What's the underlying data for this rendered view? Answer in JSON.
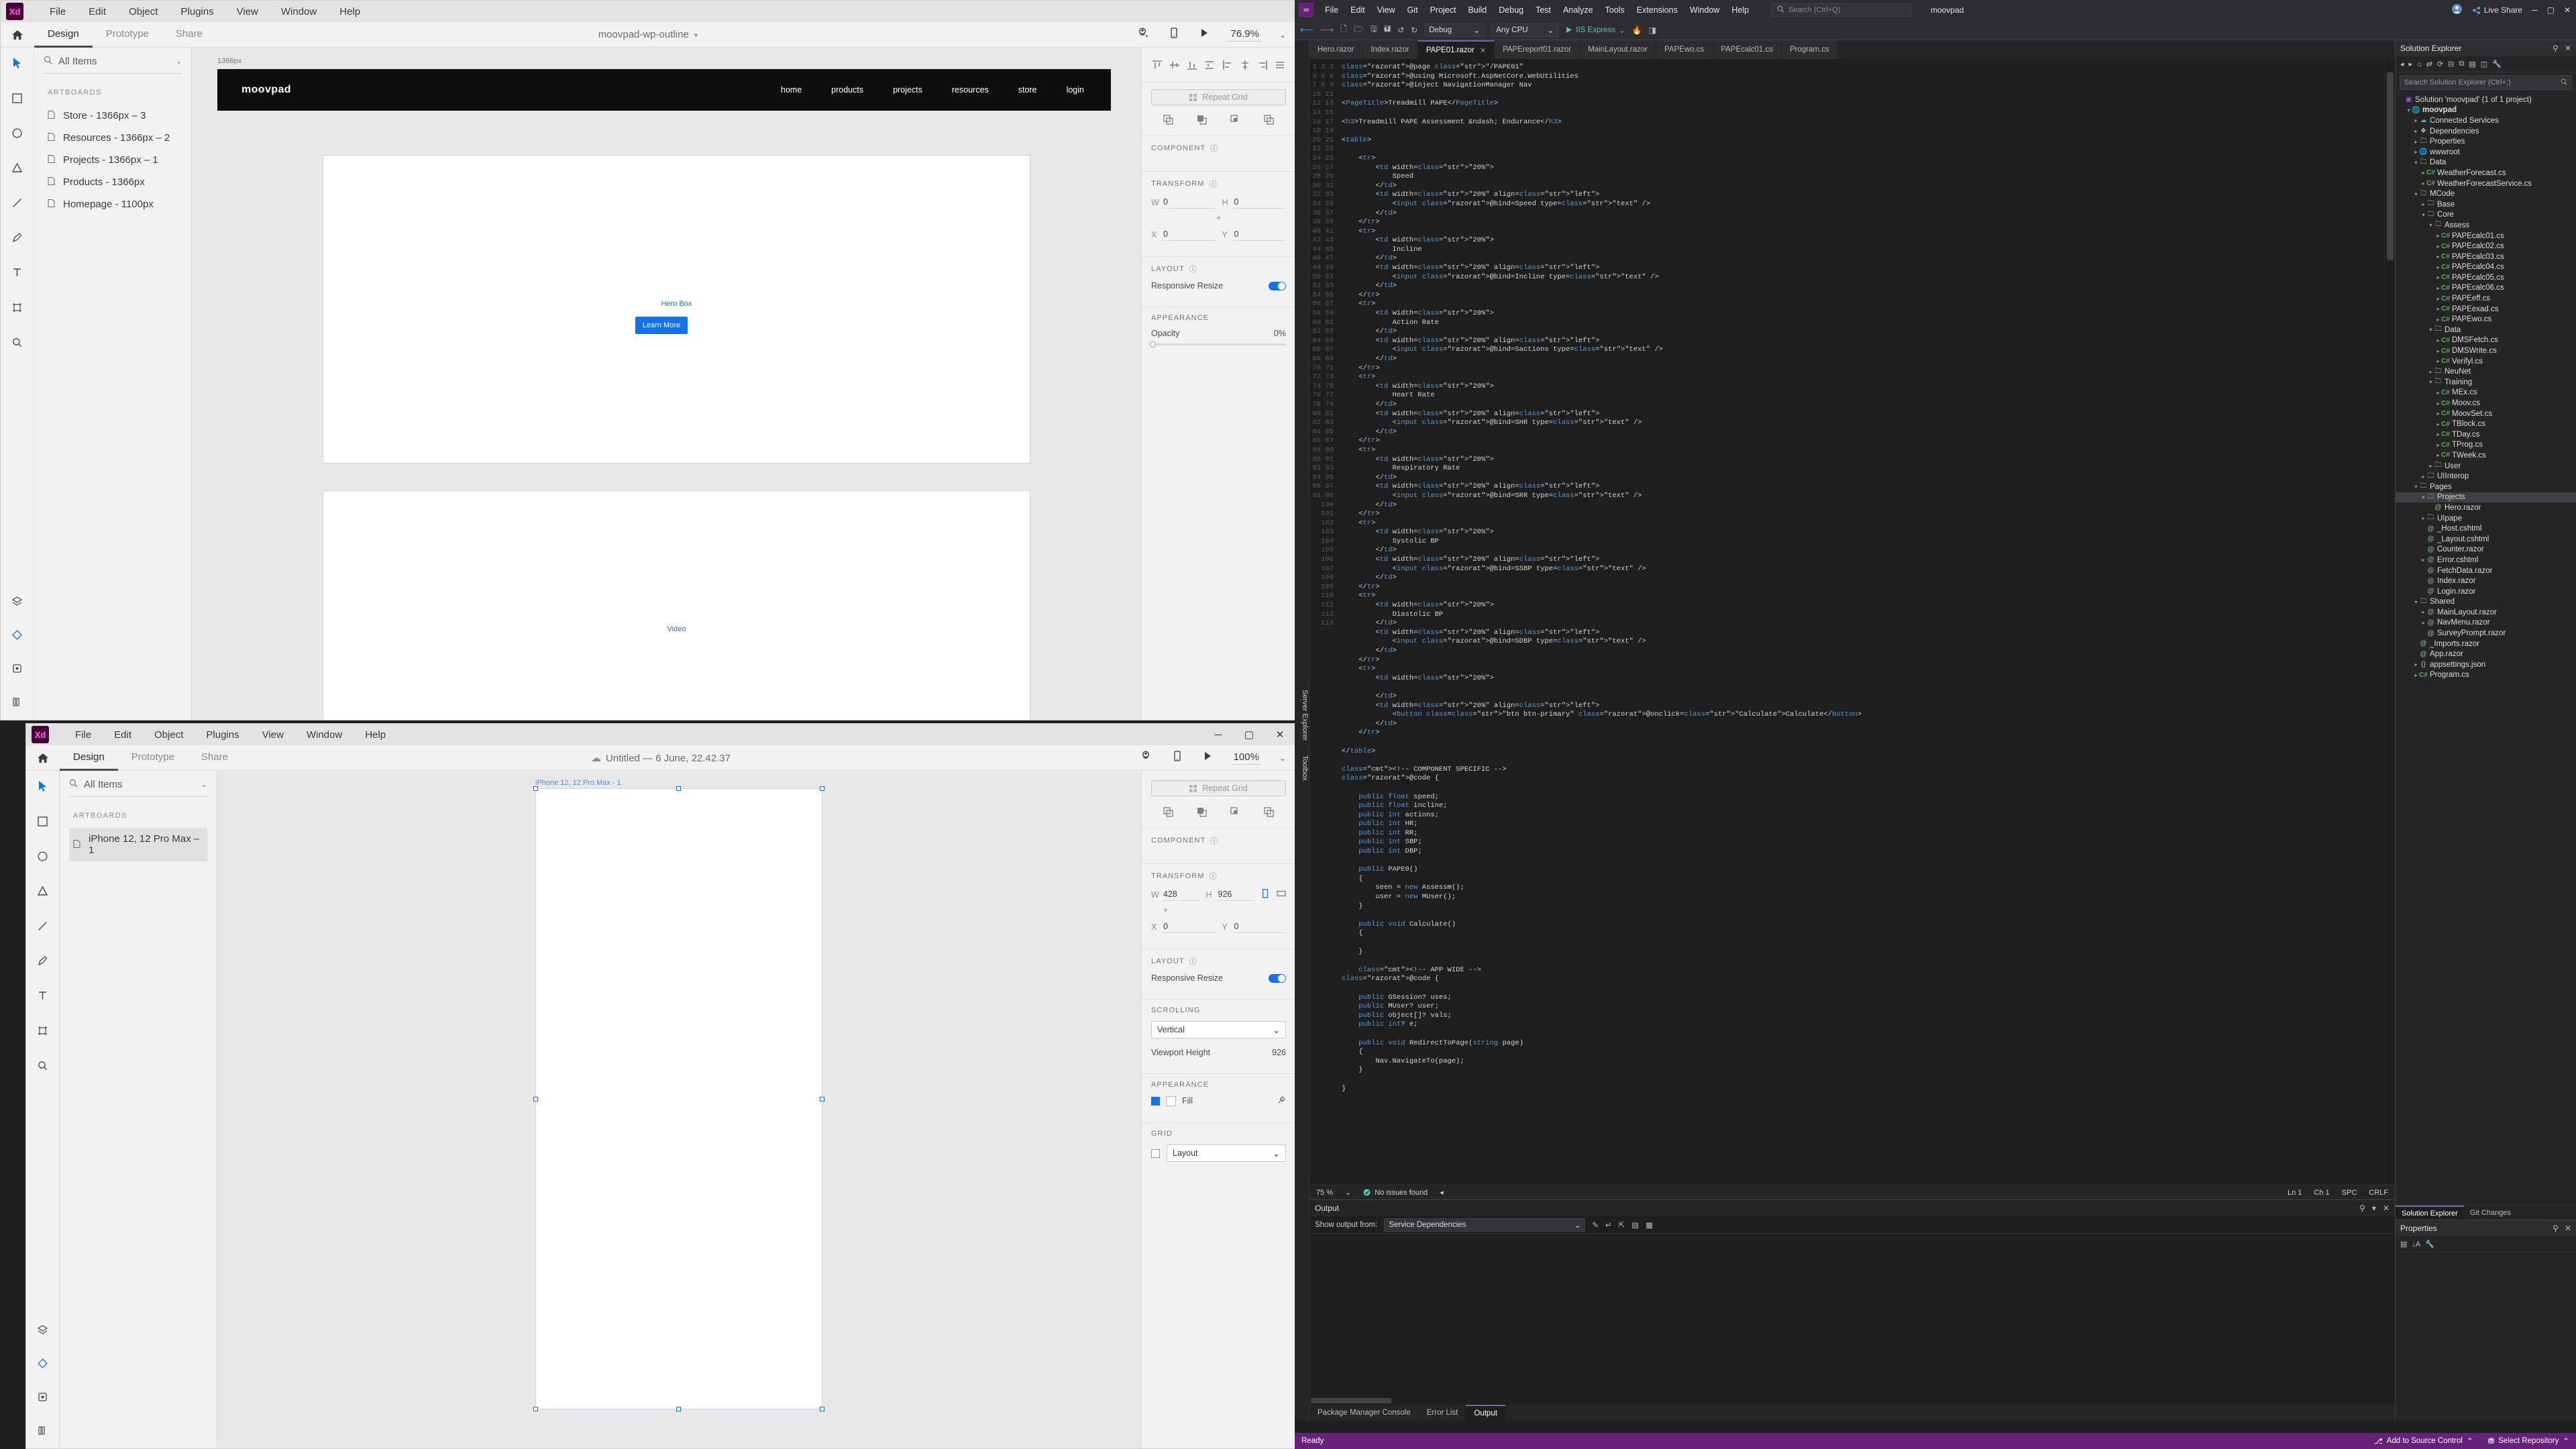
{
  "xd_top": {
    "menu": [
      "File",
      "Edit",
      "Object",
      "Plugins",
      "View",
      "Window",
      "Help"
    ],
    "logo": "Xd",
    "tabs": [
      {
        "label": "Design",
        "active": true
      },
      {
        "label": "Prototype",
        "active": false
      },
      {
        "label": "Share",
        "active": false
      }
    ],
    "document_title": "moovpad-wp-outline",
    "zoom": "76.9%",
    "search_placeholder": "All Items",
    "section_artboards": "ARTBOARDS",
    "artboards": [
      "Store - 1366px – 3",
      "Resources - 1366px – 2",
      "Projects - 1366px – 1",
      "Products - 1366px",
      "Homepage - 1100px"
    ],
    "canvas": {
      "artboard_label": "1366px",
      "nav_brand": "moovpad",
      "nav_links": [
        "home",
        "products",
        "projects",
        "resources",
        "store",
        "login"
      ],
      "hero_caption": "Hero Box",
      "hero_button": "Learn More",
      "video_caption": "Video"
    },
    "right": {
      "repeat_grid": "Repeat Grid",
      "component": "COMPONENT",
      "transform": "TRANSFORM",
      "w_label": "W",
      "w_value": "0",
      "h_label": "H",
      "h_value": "0",
      "x_label": "X",
      "x_value": "0",
      "y_label": "Y",
      "y_value": "0",
      "layout": "LAYOUT",
      "responsive_resize": "Responsive Resize",
      "appearance": "APPEARANCE",
      "opacity_label": "Opacity",
      "opacity_value": "0%"
    }
  },
  "xd_bottom": {
    "menu": [
      "File",
      "Edit",
      "Object",
      "Plugins",
      "View",
      "Window",
      "Help"
    ],
    "logo": "Xd",
    "tabs": [
      {
        "label": "Design",
        "active": true
      },
      {
        "label": "Prototype",
        "active": false
      },
      {
        "label": "Share",
        "active": false
      }
    ],
    "document_title": "Untitled — 6 June, 22.42.37",
    "zoom": "100%",
    "search_placeholder": "All Items",
    "section_artboards": "ARTBOARDS",
    "artboards": [
      "iPhone 12, 12 Pro Max – 1"
    ],
    "canvas": {
      "artboard_label": "iPhone 12, 12 Pro Max - 1"
    },
    "right": {
      "repeat_grid": "Repeat Grid",
      "component": "COMPONENT",
      "transform": "TRANSFORM",
      "w_label": "W",
      "w_value": "428",
      "h_label": "H",
      "h_value": "926",
      "x_label": "X",
      "x_value": "0",
      "y_label": "Y",
      "y_value": "0",
      "layout": "LAYOUT",
      "responsive_resize": "Responsive Resize",
      "scrolling": "SCROLLING",
      "scrolling_value": "Vertical",
      "viewport_height_label": "Viewport Height",
      "viewport_height_value": "926",
      "appearance": "APPEARANCE",
      "fill_label": "Fill",
      "grid": "GRID",
      "grid_value": "Layout"
    }
  },
  "vs": {
    "menu": [
      "File",
      "Edit",
      "View",
      "Git",
      "Project",
      "Build",
      "Debug",
      "Test",
      "Analyze",
      "Tools",
      "Extensions",
      "Window",
      "Help"
    ],
    "search_placeholder": "Search (Ctrl+Q)",
    "title": "moovpad",
    "live_share": "Live Share",
    "toolbar": {
      "config": "Debug",
      "platform": "Any CPU",
      "run_target": "IIS Express",
      "nav_back": "◄",
      "nav_fwd": "►"
    },
    "tabs": [
      {
        "label": "Hero.razor",
        "active": false
      },
      {
        "label": "Index.razor",
        "active": false
      },
      {
        "label": "PAPE01.razor",
        "active": true
      },
      {
        "label": "PAPEreport01.razor",
        "active": false
      },
      {
        "label": "MainLayout.razor",
        "active": false
      },
      {
        "label": "PAPEwo.cs",
        "active": false
      },
      {
        "label": "PAPEcalc01.cs",
        "active": false
      },
      {
        "label": "Program.cs",
        "active": false
      }
    ],
    "server_rail": "Server Explorer",
    "toolbox_rail": "Toolbox",
    "editor_status": {
      "zoom": "75 %",
      "issues": "No issues found",
      "ln": "Ln 1",
      "col": "Ch 1",
      "spc": "SPC",
      "eol": "CRLF"
    },
    "output": {
      "title": "Output",
      "show_output_from_label": "Show output from:",
      "show_output_from_value": "Service Dependencies",
      "tabs": [
        {
          "label": "Package Manager Console",
          "active": false
        },
        {
          "label": "Error List",
          "active": false
        },
        {
          "label": "Output",
          "active": true
        }
      ]
    },
    "solution_explorer": {
      "title": "Solution Explorer",
      "search_placeholder": "Search Solution Explorer (Ctrl+;)",
      "tabs": [
        {
          "label": "Solution Explorer",
          "active": true
        },
        {
          "label": "Git Changes",
          "active": false
        }
      ],
      "tree": [
        {
          "depth": 0,
          "arrow": "",
          "icon": "sln",
          "label": "Solution 'moovpad' (1 of 1 project)",
          "bold": false
        },
        {
          "depth": 1,
          "arrow": "▾",
          "icon": "web",
          "label": "moovpad",
          "bold": true
        },
        {
          "depth": 2,
          "arrow": "▸",
          "icon": "svc",
          "label": "Connected Services",
          "bold": false
        },
        {
          "depth": 2,
          "arrow": "▸",
          "icon": "dep",
          "label": "Dependencies",
          "bold": false
        },
        {
          "depth": 2,
          "arrow": "▸",
          "icon": "prop",
          "label": "Properties",
          "bold": false
        },
        {
          "depth": 2,
          "arrow": "▸",
          "icon": "web",
          "label": "wwwroot",
          "bold": false
        },
        {
          "depth": 2,
          "arrow": "▾",
          "icon": "folder",
          "label": "Data",
          "bold": false
        },
        {
          "depth": 3,
          "arrow": "▸",
          "icon": "cs",
          "label": "WeatherForecast.cs",
          "bold": false
        },
        {
          "depth": 3,
          "arrow": "▸",
          "icon": "cs",
          "label": "WeatherForecastService.cs",
          "bold": false
        },
        {
          "depth": 2,
          "arrow": "▾",
          "icon": "folder",
          "label": "MCode",
          "bold": false
        },
        {
          "depth": 3,
          "arrow": "▸",
          "icon": "folder",
          "label": "Base",
          "bold": false
        },
        {
          "depth": 3,
          "arrow": "▾",
          "icon": "folder",
          "label": "Core",
          "bold": false
        },
        {
          "depth": 4,
          "arrow": "▾",
          "icon": "folder",
          "label": "Assess",
          "bold": false
        },
        {
          "depth": 5,
          "arrow": "▸",
          "icon": "cs",
          "label": "PAPEcalc01.cs",
          "bold": false
        },
        {
          "depth": 5,
          "arrow": "▸",
          "icon": "cs",
          "label": "PAPEcalc02.cs",
          "bold": false
        },
        {
          "depth": 5,
          "arrow": "▸",
          "icon": "cs",
          "label": "PAPEcalc03.cs",
          "bold": false
        },
        {
          "depth": 5,
          "arrow": "▸",
          "icon": "cs",
          "label": "PAPEcalc04.cs",
          "bold": false
        },
        {
          "depth": 5,
          "arrow": "▸",
          "icon": "cs",
          "label": "PAPEcalc05.cs",
          "bold": false
        },
        {
          "depth": 5,
          "arrow": "▸",
          "icon": "cs",
          "label": "PAPEcalc06.cs",
          "bold": false
        },
        {
          "depth": 5,
          "arrow": "▸",
          "icon": "cs",
          "label": "PAPEeff.cs",
          "bold": false
        },
        {
          "depth": 5,
          "arrow": "▸",
          "icon": "cs",
          "label": "PAPEexad.cs",
          "bold": false
        },
        {
          "depth": 5,
          "arrow": "▸",
          "icon": "cs",
          "label": "PAPEwo.cs",
          "bold": false
        },
        {
          "depth": 4,
          "arrow": "▾",
          "icon": "folder",
          "label": "Data",
          "bold": false
        },
        {
          "depth": 5,
          "arrow": "▸",
          "icon": "cs",
          "label": "DMSFetch.cs",
          "bold": false
        },
        {
          "depth": 5,
          "arrow": "▸",
          "icon": "cs",
          "label": "DMSWrite.cs",
          "bold": false
        },
        {
          "depth": 5,
          "arrow": "▸",
          "icon": "cs",
          "label": "Verifyl.cs",
          "bold": false
        },
        {
          "depth": 4,
          "arrow": "▸",
          "icon": "folder",
          "label": "NeuNet",
          "bold": false
        },
        {
          "depth": 4,
          "arrow": "▾",
          "icon": "folder",
          "label": "Training",
          "bold": false
        },
        {
          "depth": 5,
          "arrow": "▸",
          "icon": "cs",
          "label": "MEx.cs",
          "bold": false
        },
        {
          "depth": 5,
          "arrow": "▸",
          "icon": "cs",
          "label": "Moov.cs",
          "bold": false
        },
        {
          "depth": 5,
          "arrow": "▸",
          "icon": "cs",
          "label": "MoovSet.cs",
          "bold": false
        },
        {
          "depth": 5,
          "arrow": "▸",
          "icon": "cs",
          "label": "TBlock.cs",
          "bold": false
        },
        {
          "depth": 5,
          "arrow": "▸",
          "icon": "cs",
          "label": "TDay.cs",
          "bold": false
        },
        {
          "depth": 5,
          "arrow": "▸",
          "icon": "cs",
          "label": "TProg.cs",
          "bold": false
        },
        {
          "depth": 5,
          "arrow": "▸",
          "icon": "cs",
          "label": "TWeek.cs",
          "bold": false
        },
        {
          "depth": 4,
          "arrow": "▸",
          "icon": "folder",
          "label": "User",
          "bold": false
        },
        {
          "depth": 3,
          "arrow": "▸",
          "icon": "folder",
          "label": "UIInterop",
          "bold": false
        },
        {
          "depth": 2,
          "arrow": "▾",
          "icon": "folder",
          "label": "Pages",
          "bold": false
        },
        {
          "depth": 3,
          "arrow": "▾",
          "icon": "folder",
          "label": "Projects",
          "bold": false,
          "selected": true
        },
        {
          "depth": 4,
          "arrow": "",
          "icon": "razor",
          "label": "Hero.razor",
          "bold": false
        },
        {
          "depth": 3,
          "arrow": "▸",
          "icon": "folder",
          "label": "UIpape",
          "bold": false
        },
        {
          "depth": 3,
          "arrow": "",
          "icon": "razor",
          "label": "_Host.cshtml",
          "bold": false
        },
        {
          "depth": 3,
          "arrow": "",
          "icon": "razor",
          "label": "_Layout.cshtml",
          "bold": false
        },
        {
          "depth": 3,
          "arrow": "",
          "icon": "razor",
          "label": "Counter.razor",
          "bold": false
        },
        {
          "depth": 3,
          "arrow": "▸",
          "icon": "razor",
          "label": "Error.cshtml",
          "bold": false
        },
        {
          "depth": 3,
          "arrow": "",
          "icon": "razor",
          "label": "FetchData.razor",
          "bold": false
        },
        {
          "depth": 3,
          "arrow": "",
          "icon": "razor",
          "label": "Index.razor",
          "bold": false
        },
        {
          "depth": 3,
          "arrow": "",
          "icon": "razor",
          "label": "Login.razor",
          "bold": false
        },
        {
          "depth": 2,
          "arrow": "▾",
          "icon": "folder",
          "label": "Shared",
          "bold": false
        },
        {
          "depth": 3,
          "arrow": "▸",
          "icon": "razor",
          "label": "MainLayout.razor",
          "bold": false
        },
        {
          "depth": 3,
          "arrow": "▸",
          "icon": "razor",
          "label": "NavMenu.razor",
          "bold": false
        },
        {
          "depth": 3,
          "arrow": "",
          "icon": "razor",
          "label": "SurveyPrompt.razor",
          "bold": false
        },
        {
          "depth": 2,
          "arrow": "",
          "icon": "razor",
          "label": "_Imports.razor",
          "bold": false
        },
        {
          "depth": 2,
          "arrow": "",
          "icon": "razor",
          "label": "App.razor",
          "bold": false
        },
        {
          "depth": 2,
          "arrow": "▸",
          "icon": "json",
          "label": "appsettings.json",
          "bold": false
        },
        {
          "depth": 2,
          "arrow": "▸",
          "icon": "cs",
          "label": "Program.cs",
          "bold": false
        }
      ]
    },
    "properties": {
      "title": "Properties"
    },
    "statusbar": {
      "ready": "Ready",
      "add_to_source_control": "Add to Source Control",
      "select_repository": "Select Repository"
    },
    "code_lines": [
      "@page \"/PAPE01\"",
      "@using Microsoft.AspNetCore.WebUtilities",
      "@inject NavigationManager Nav",
      "",
      "<PageTitle>Treadmill PAPE</PageTitle>",
      "",
      "<h3>Treadmill PAPE Assessment &ndash; Endurance</h3>",
      "",
      "<table>",
      "",
      "    <tr>",
      "        <td width=\"20%\">",
      "            Speed",
      "        </td>",
      "        <td width=\"20%\" align=\"left\">",
      "            <input @bind=Speed type=\"text\" />",
      "        </td>",
      "    </tr>",
      "    <tr>",
      "        <td width=\"20%\">",
      "            Incline",
      "        </td>",
      "        <td width=\"20%\" align=\"left\">",
      "            <input @bind=Incline type=\"text\" />",
      "        </td>",
      "    </tr>",
      "    <tr>",
      "        <td width=\"20%\">",
      "            Action Rate",
      "        </td>",
      "        <td width=\"20%\" align=\"left\">",
      "            <input @bind=Sactions type=\"text\" />",
      "        </td>",
      "    </tr>",
      "    <tr>",
      "        <td width=\"20%\">",
      "            Heart Rate",
      "        </td>",
      "        <td width=\"20%\" align=\"left\">",
      "            <input @bind=SHR type=\"text\" />",
      "        </td>",
      "    </tr>",
      "    <tr>",
      "        <td width=\"20%\">",
      "            Respiratory Rate",
      "        </td>",
      "        <td width=\"20%\" align=\"left\">",
      "            <input @bind=SRR type=\"text\" />",
      "        </td>",
      "    </tr>",
      "    <tr>",
      "        <td width=\"20%\">",
      "            Systolic BP",
      "        </td>",
      "        <td width=\"20%\" align=\"left\">",
      "            <input @bind=SSBP type=\"text\" />",
      "        </td>",
      "    </tr>",
      "    <tr>",
      "        <td width=\"20%\">",
      "            Diastolic BP",
      "        </td>",
      "        <td width=\"20%\" align=\"left\">",
      "            <input @bind=SDBP type=\"text\" />",
      "        </td>",
      "    </tr>",
      "    <tr>",
      "        <td width=\"20%\">",
      "",
      "        </td>",
      "        <td width=\"20%\" align=\"left\">",
      "            <button class=\"btn btn-primary\" @onclick=\"Calculate\">Calculate</button>",
      "        </td>",
      "    </tr>",
      "",
      "</table>",
      "",
      "<!-- COMPONENT SPECIFIC -->",
      "@code {",
      "",
      "    public float speed;",
      "    public float incline;",
      "    public int actions;",
      "    public int HR;",
      "    public int RR;",
      "    public int SBP;",
      "    public int DBP;",
      "",
      "    public PAPE0()",
      "    {",
      "        seen = new Assessm();",
      "        user = new MUser();",
      "    }",
      "",
      "    public void Calculate()",
      "    {",
      "",
      "    }",
      "",
      "    <!-- APP WIDE -->",
      "@code {",
      "",
      "    public GSession? uses;",
      "    public MUser? user;",
      "    public object[]? vals;",
      "    public int? e;",
      "",
      "    public void RedirectToPage(string page)",
      "    {",
      "        Nav.NavigateTo(page);",
      "    }",
      "",
      "}"
    ]
  }
}
